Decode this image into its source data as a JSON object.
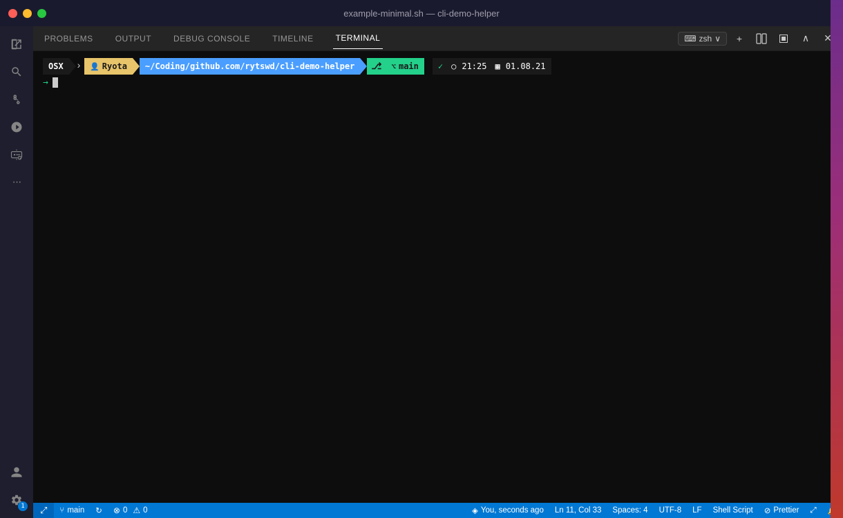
{
  "titleBar": {
    "title": "example-minimal.sh — cli-demo-helper"
  },
  "activityBar": {
    "icons": [
      {
        "name": "explorer-icon",
        "symbol": "⎘",
        "label": "Explorer"
      },
      {
        "name": "search-icon",
        "symbol": "🔍",
        "label": "Search"
      },
      {
        "name": "source-control-icon",
        "symbol": "⑂",
        "label": "Source Control"
      },
      {
        "name": "run-debug-icon",
        "symbol": "▷",
        "label": "Run and Debug"
      },
      {
        "name": "remote-explorer-icon",
        "symbol": "⊡",
        "label": "Remote Explorer"
      },
      {
        "name": "more-icon",
        "symbol": "…",
        "label": "More"
      }
    ],
    "bottomIcons": [
      {
        "name": "account-icon",
        "symbol": "👤",
        "label": "Account"
      },
      {
        "name": "settings-icon",
        "symbol": "⚙",
        "label": "Settings",
        "badge": "1"
      }
    ]
  },
  "panelTabs": [
    {
      "label": "PROBLEMS",
      "active": false
    },
    {
      "label": "OUTPUT",
      "active": false
    },
    {
      "label": "DEBUG CONSOLE",
      "active": false
    },
    {
      "label": "TIMELINE",
      "active": false
    },
    {
      "label": "TERMINAL",
      "active": true
    }
  ],
  "terminalHeader": {
    "shellLabel": "zsh",
    "addButton": "+",
    "splitButton": "⧉",
    "killButton": "🗑",
    "collapseButton": "∧",
    "closeButton": "✕"
  },
  "terminal": {
    "prompt": {
      "osx": "OSX",
      "chevron": "›",
      "userIcon": "👤",
      "username": "Ryota",
      "path": "~/Coding/github.com/rytswd/cli-demo-helper",
      "gitIcon": "⎇",
      "branchIcon": "⌥",
      "branch": "main",
      "statusCheck": "✓",
      "clockIcon": "○",
      "time": "21:25",
      "calendarIcon": "▦",
      "date": "01.08.21"
    },
    "cursorLine": "→"
  },
  "statusBar": {
    "branch": "main",
    "syncIcon": "↻",
    "errors": "0",
    "warnings": "0",
    "sourceControl": "You, seconds ago",
    "position": "Ln 11, Col 33",
    "spaces": "Spaces: 4",
    "encoding": "UTF-8",
    "lineEnding": "LF",
    "language": "Shell Script",
    "formatter": "Prettier",
    "notificationsIcon": "🔔"
  }
}
